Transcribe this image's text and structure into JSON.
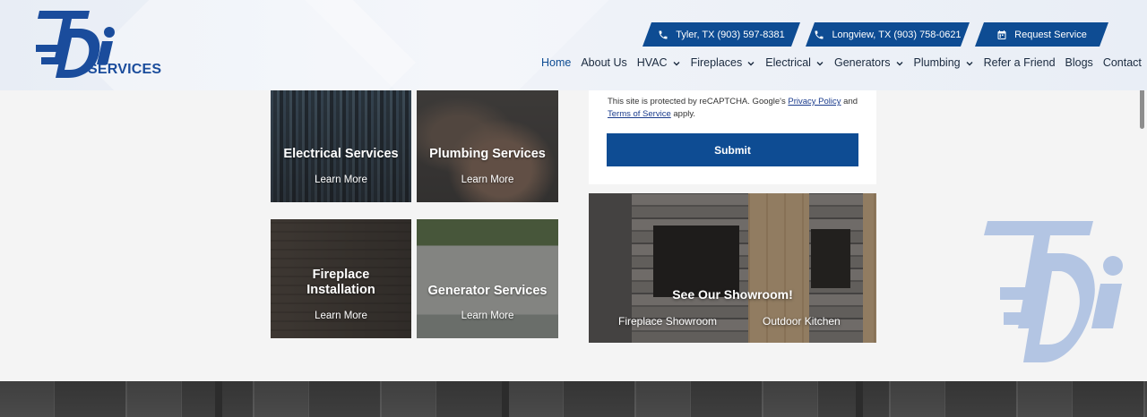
{
  "header": {
    "logo_text": "SERVICES",
    "contacts": [
      {
        "label": "Tyler, TX (903) 597-8381",
        "icon": "phone-icon"
      },
      {
        "label": "Longview, TX (903) 758-0621",
        "icon": "phone-icon"
      },
      {
        "label": "Request Service",
        "icon": "calendar-icon"
      }
    ],
    "nav": [
      {
        "label": "Home",
        "active": true,
        "dropdown": false
      },
      {
        "label": "About Us",
        "active": false,
        "dropdown": false
      },
      {
        "label": "HVAC",
        "active": false,
        "dropdown": true
      },
      {
        "label": "Fireplaces",
        "active": false,
        "dropdown": true
      },
      {
        "label": "Electrical",
        "active": false,
        "dropdown": true
      },
      {
        "label": "Generators",
        "active": false,
        "dropdown": true
      },
      {
        "label": "Plumbing",
        "active": false,
        "dropdown": true
      },
      {
        "label": "Refer a Friend",
        "active": false,
        "dropdown": false
      },
      {
        "label": "Blogs",
        "active": false,
        "dropdown": false
      },
      {
        "label": "Contact",
        "active": false,
        "dropdown": false
      }
    ]
  },
  "services": [
    {
      "title": "Electrical Services",
      "link": "Learn More"
    },
    {
      "title": "Plumbing Services",
      "link": "Learn More"
    },
    {
      "title": "Fireplace Installation",
      "link": "Learn More"
    },
    {
      "title": "Generator Services",
      "link": "Learn More"
    }
  ],
  "form": {
    "captcha_prefix": "This site is protected by reCAPTCHA. Google's",
    "privacy_link": "Privacy Policy",
    "and": "and",
    "terms_link": "Terms of Service",
    "apply": "apply.",
    "submit_label": "Submit"
  },
  "showroom": {
    "title": "See Our Showroom!",
    "link_1": "Fireplace Showroom",
    "link_2": "Outdoor Kitchen"
  },
  "colors": {
    "brand_blue": "#0e4c93",
    "logo_blue": "#1a4c9c",
    "watermark_blue": "#b3c5e3"
  }
}
